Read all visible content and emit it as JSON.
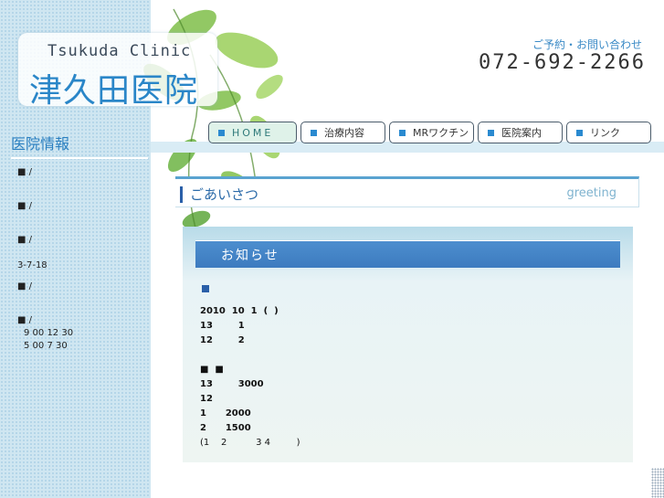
{
  "header": {
    "logo_en": "Tsukuda Clinic",
    "logo_jp": "津久田医院",
    "contact_label": "ご予約・お問い合わせ",
    "phone": "072-692-2266"
  },
  "nav": [
    {
      "label": "HOME"
    },
    {
      "label": "治療内容"
    },
    {
      "label": "MRワクチン"
    },
    {
      "label": "医院案内"
    },
    {
      "label": "リンク"
    }
  ],
  "sidebar": {
    "title": "医院情報",
    "items": [
      {
        "text": "■ /"
      },
      {
        "text": "■ /"
      },
      {
        "text": "■ /"
      },
      {
        "text": "3-7-18"
      },
      {
        "text": "■ /"
      },
      {
        "text": "■ /"
      },
      {
        "text": "9 00 12 30"
      },
      {
        "text": "5 00  7 30"
      }
    ]
  },
  "greeting": {
    "title_jp": "ごあいさつ",
    "title_en": "greeting"
  },
  "notice": {
    "title": "お知らせ",
    "lines": [
      "2010  10  1  (  )",
      "13        1",
      "12        2",
      "■  ■",
      "13        3000",
      "12",
      "1      2000",
      "2      1500",
      "(1    2          3 4         )"
    ]
  },
  "colors": {
    "accent": "#2a86c8",
    "sidebar_bg": "#cfe6f1",
    "panel_head": "#3c7bbf"
  }
}
